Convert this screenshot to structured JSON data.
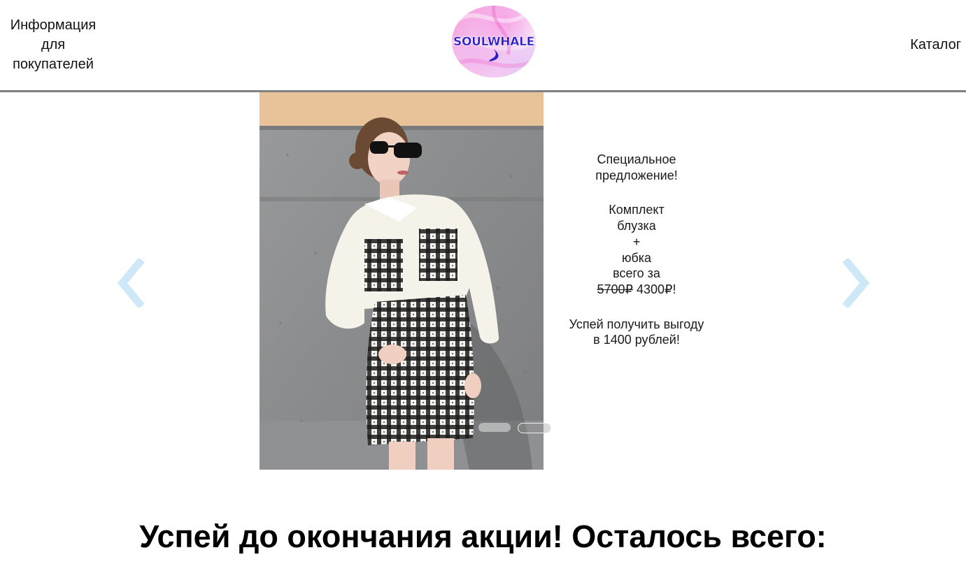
{
  "header": {
    "info_link": "Информация для покупателей",
    "catalog_link": "Каталог",
    "logo_text": "SOULWHALE"
  },
  "carousel": {
    "slides_count": 2,
    "active_slide": 1,
    "offer": {
      "title_line1": "Специальное",
      "title_line2": "предложение!",
      "item_line1": "Комплект",
      "item_line2": "блузка",
      "item_line3": "+",
      "item_line4": "юбка",
      "item_line5": "всего за",
      "old_price": "5700₽",
      "new_price": "4300₽!",
      "cta_line1": "Успей получить выгоду",
      "cta_line2": "в 1400 рублей!"
    },
    "arrow_color": "#cfe8f7"
  },
  "promo": {
    "heading": "Успей до окончания акции! Осталось всего:"
  },
  "colors": {
    "logo_text": "#2a1fc9",
    "logo_bg": "#f4a9e2",
    "header_border": "#808080"
  }
}
